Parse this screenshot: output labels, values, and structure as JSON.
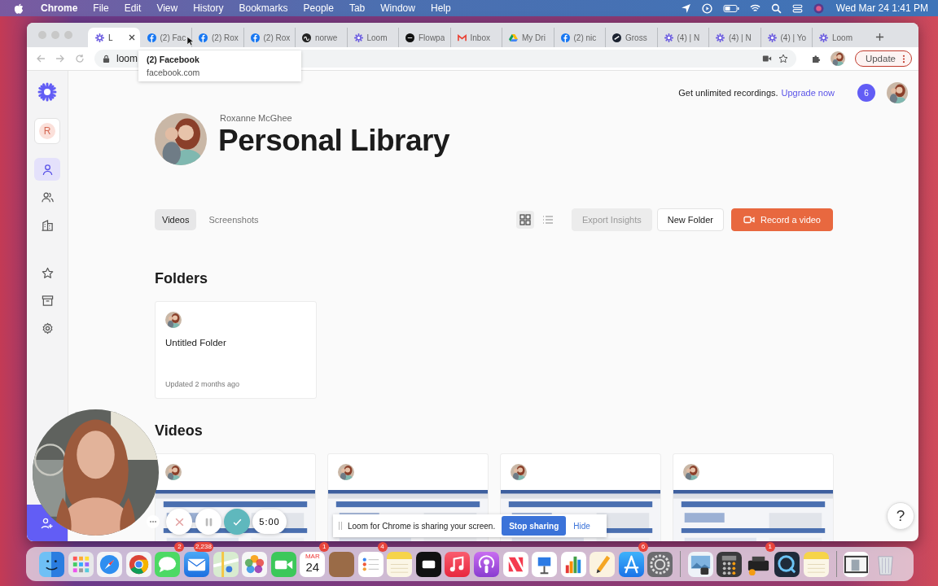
{
  "menu_bar": {
    "app": "Chrome",
    "items": [
      "File",
      "Edit",
      "View",
      "History",
      "Bookmarks",
      "People",
      "Tab",
      "Window",
      "Help"
    ],
    "clock": "Wed Mar 24  1:41 PM"
  },
  "tabs": [
    {
      "title": "L",
      "kind": "loom",
      "selected": true
    },
    {
      "title": "(2) Fac",
      "kind": "facebook",
      "selected": false
    },
    {
      "title": "(2) Rox",
      "kind": "facebook",
      "selected": false
    },
    {
      "title": "(2) Rox",
      "kind": "facebook",
      "selected": false
    },
    {
      "title": "norwe",
      "kind": "norwex",
      "selected": false
    },
    {
      "title": "Loom",
      "kind": "loom",
      "selected": false
    },
    {
      "title": "Flowpa",
      "kind": "flowpage",
      "selected": false
    },
    {
      "title": "Inbox",
      "kind": "gmail",
      "selected": false
    },
    {
      "title": "My Dri",
      "kind": "drive",
      "selected": false
    },
    {
      "title": "(2) nic",
      "kind": "facebook",
      "selected": false
    },
    {
      "title": "Gross",
      "kind": "gross",
      "selected": false
    },
    {
      "title": "(4) | N",
      "kind": "loom",
      "selected": false
    },
    {
      "title": "(4) | N",
      "kind": "loom",
      "selected": false
    },
    {
      "title": "(4) | Yo",
      "kind": "loom",
      "selected": false
    },
    {
      "title": "Loom",
      "kind": "loom",
      "selected": false
    }
  ],
  "tooltip": {
    "title": "(2) Facebook",
    "url": "facebook.com"
  },
  "address": "loom",
  "update_button": "Update",
  "workspace": {
    "initial": "R"
  },
  "nav": [
    {
      "kind": "person",
      "selected": true
    },
    {
      "kind": "people",
      "selected": false
    },
    {
      "kind": "building",
      "selected": false
    },
    {
      "kind": "star",
      "selected": false
    },
    {
      "kind": "archive",
      "selected": false
    },
    {
      "kind": "settings",
      "selected": false
    }
  ],
  "banner": {
    "text": "Get unlimited recordings.",
    "link": "Upgrade now",
    "badge": "6"
  },
  "owner": "Roxanne McGhee",
  "title": "Personal Library",
  "view_tabs": [
    {
      "label": "Videos",
      "selected": true
    },
    {
      "label": "Screenshots",
      "selected": false
    }
  ],
  "layout_toggle": [
    {
      "kind": "grid",
      "selected": true
    },
    {
      "kind": "list",
      "selected": false
    }
  ],
  "actions": [
    {
      "label": "Export Insights",
      "kind": "secondary",
      "disabled": true
    },
    {
      "label": "New Folder",
      "kind": "secondary",
      "disabled": false
    },
    {
      "label": "Record a video",
      "kind": "primary",
      "disabled": false
    }
  ],
  "folders": {
    "heading": "Folders",
    "items": [
      {
        "name": "Untitled Folder",
        "updated": "Updated 2 months ago"
      }
    ]
  },
  "videos": {
    "heading": "Videos"
  },
  "recorder": {
    "timer": "5:00"
  },
  "share_bar": {
    "text": "Loom for Chrome is sharing your screen.",
    "stop": "Stop sharing",
    "hide": "Hide"
  },
  "help": "?",
  "dock": {
    "badges": [
      "2",
      "2,238",
      "1",
      "4",
      "6",
      "1"
    ],
    "calendar_month": "MAR",
    "calendar_day": "24"
  }
}
